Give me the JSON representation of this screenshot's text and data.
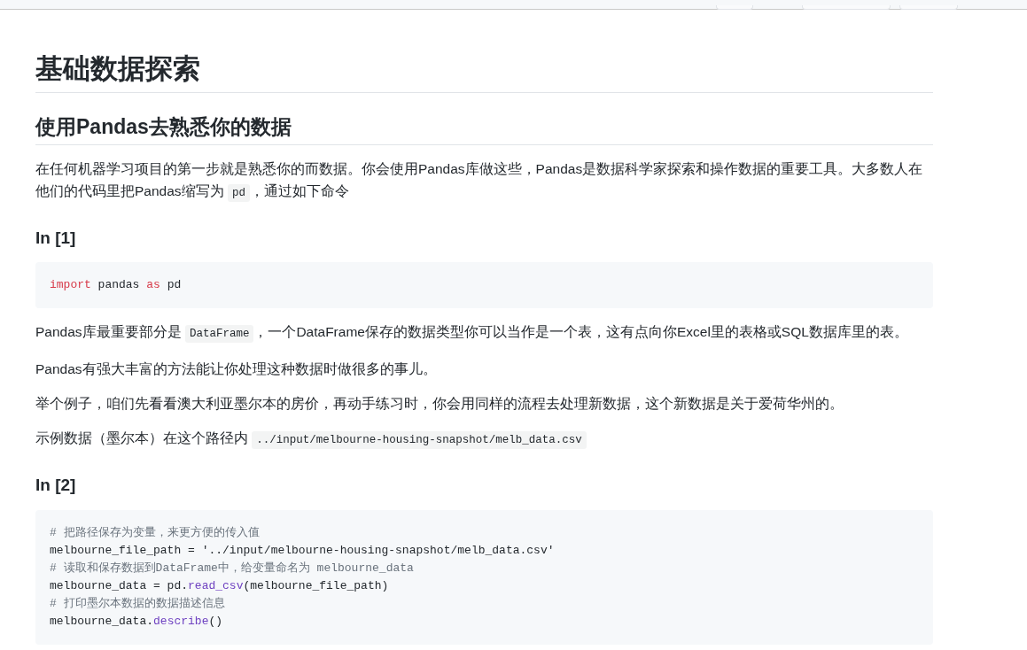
{
  "blocks": [
    {
      "kind": "h1",
      "text": "基础数据探索"
    },
    {
      "kind": "h2",
      "text": "使用Pandas去熟悉你的数据"
    },
    {
      "kind": "p",
      "segments": [
        {
          "kind": "text",
          "text": "在任何机器学习项目的第一步就是熟悉你的而数据。你会使用Pandas库做这些，Pandas是数据科学家探索和操作数据的重要工具。大多数人在他们的代码里把Pandas缩写为 "
        },
        {
          "kind": "code",
          "text": "pd"
        },
        {
          "kind": "text",
          "text": "，通过如下命令"
        }
      ]
    },
    {
      "kind": "h3",
      "text": "In [1]"
    },
    {
      "kind": "code",
      "lines": [
        [
          {
            "kind": "keyword",
            "text": "import"
          },
          {
            "kind": "plain",
            "text": " pandas "
          },
          {
            "kind": "keyword",
            "text": "as"
          },
          {
            "kind": "plain",
            "text": " pd"
          }
        ]
      ]
    },
    {
      "kind": "p",
      "segments": [
        {
          "kind": "text",
          "text": "Pandas库最重要部分是 "
        },
        {
          "kind": "code",
          "text": "DataFrame"
        },
        {
          "kind": "text",
          "text": "，一个DataFrame保存的数据类型你可以当作是一个表，这有点向你Excel里的表格或SQL数据库里的表。"
        }
      ]
    },
    {
      "kind": "p",
      "segments": [
        {
          "kind": "text",
          "text": "Pandas有强大丰富的方法能让你处理这种数据时做很多的事儿。"
        }
      ]
    },
    {
      "kind": "p",
      "segments": [
        {
          "kind": "text",
          "text": "举个例子，咱们先看看澳大利亚墨尔本的房价，再动手练习时，你会用同样的流程去处理新数据，这个新数据是关于爱荷华州的。"
        }
      ]
    },
    {
      "kind": "p",
      "segments": [
        {
          "kind": "text",
          "text": "示例数据（墨尔本）在这个路径内 "
        },
        {
          "kind": "code",
          "text": "../input/melbourne-housing-snapshot/melb_data.csv"
        }
      ]
    },
    {
      "kind": "h3",
      "text": "In [2]"
    },
    {
      "kind": "code",
      "lines": [
        [
          {
            "kind": "comment",
            "text": "# 把路径保存为变量，来更方便的传入值"
          }
        ],
        [
          {
            "kind": "plain",
            "text": "melbourne_file_path = '../input/melbourne-housing-snapshot/melb_data.csv'"
          }
        ],
        [
          {
            "kind": "comment",
            "text": "# 读取和保存数据到DataFrame中，给变量命名为 melbourne_data"
          }
        ],
        [
          {
            "kind": "plain",
            "text": "melbourne_data = pd."
          },
          {
            "kind": "function",
            "text": "read_csv"
          },
          {
            "kind": "plain",
            "text": "(melbourne_file_path)"
          }
        ],
        [
          {
            "kind": "comment",
            "text": "# 打印墨尔本数据的数据描述信息"
          }
        ],
        [
          {
            "kind": "plain",
            "text": "melbourne_data."
          },
          {
            "kind": "function",
            "text": "describe"
          },
          {
            "kind": "plain",
            "text": "()"
          }
        ]
      ]
    }
  ]
}
